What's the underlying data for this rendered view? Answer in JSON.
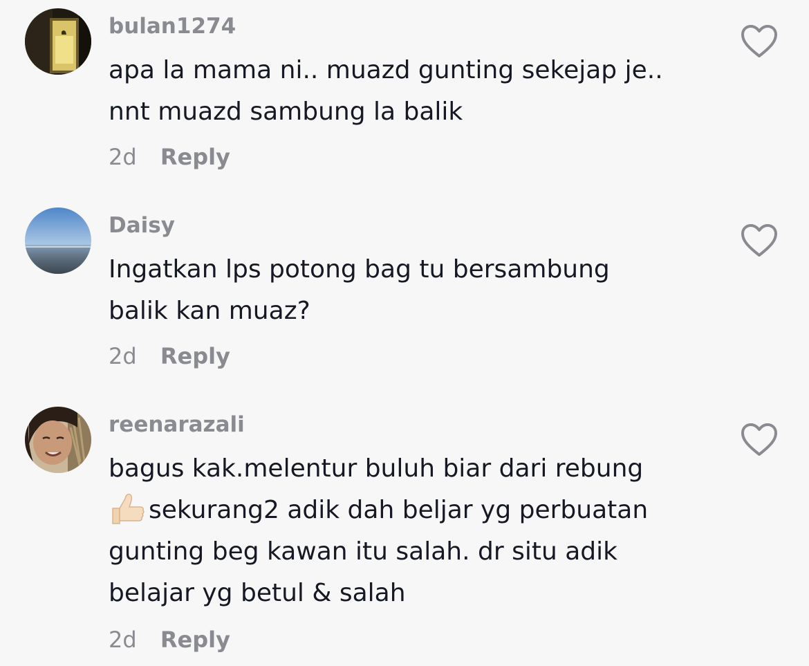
{
  "comments": [
    {
      "username": "bulan1274",
      "lines": [
        "apa la mama ni.. muazd gunting sekejap je..",
        "nnt muazd sambung la balik"
      ],
      "time": "2d",
      "reply_label": "Reply",
      "avatar": "dark-lamp-avatar"
    },
    {
      "username": "Daisy",
      "lines": [
        "Ingatkan lps potong bag tu bersambung",
        "balik kan muaz?"
      ],
      "time": "2d",
      "reply_label": "Reply",
      "avatar": "sea-sky-avatar"
    },
    {
      "username": "reenarazali",
      "lines": [
        "bagus kak.melentur buluh biar dari rebung",
        "sekurang2 adik dah beljar yg perbuatan",
        "gunting beg kawan itu salah. dr situ adik",
        "belajar yg betul & salah"
      ],
      "time": "2d",
      "reply_label": "Reply",
      "avatar": "smiling-woman-avatar",
      "emoji": "thumbs-up-icon"
    }
  ],
  "icons": {
    "like": "heart-outline-icon"
  },
  "colors": {
    "background": "#f7f7f7",
    "username": "#8a8b91",
    "text": "#161823",
    "meta": "#8a8b91"
  }
}
